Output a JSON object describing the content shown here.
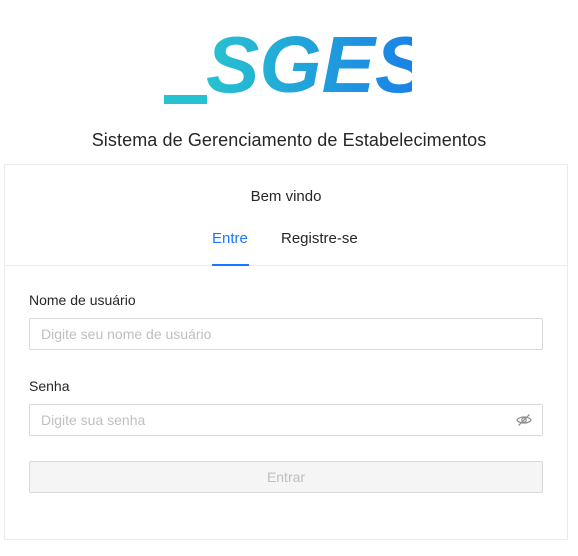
{
  "brand": {
    "logo_text": "_SGES",
    "system_name": "Sistema de Gerenciamento de Estabelecimentos",
    "colors": {
      "gradient_start": "#27c2cf",
      "gradient_end": "#1a7de8"
    }
  },
  "card": {
    "welcome": "Bem vindo",
    "tabs": [
      {
        "label": "Entre",
        "active": true
      },
      {
        "label": "Registre-se",
        "active": false
      }
    ]
  },
  "form": {
    "username": {
      "label": "Nome de usuário",
      "placeholder": "Digite seu nome de usuário",
      "value": ""
    },
    "password": {
      "label": "Senha",
      "placeholder": "Digite sua senha",
      "value": "",
      "toggle_icon": "eye-invisible-icon"
    },
    "submit_label": "Entrar"
  },
  "colors": {
    "accent": "#1677ff",
    "text": "#262626",
    "placeholder": "#bfbfbf",
    "border": "#d9d9d9",
    "disabled_bg": "#f5f5f5"
  }
}
